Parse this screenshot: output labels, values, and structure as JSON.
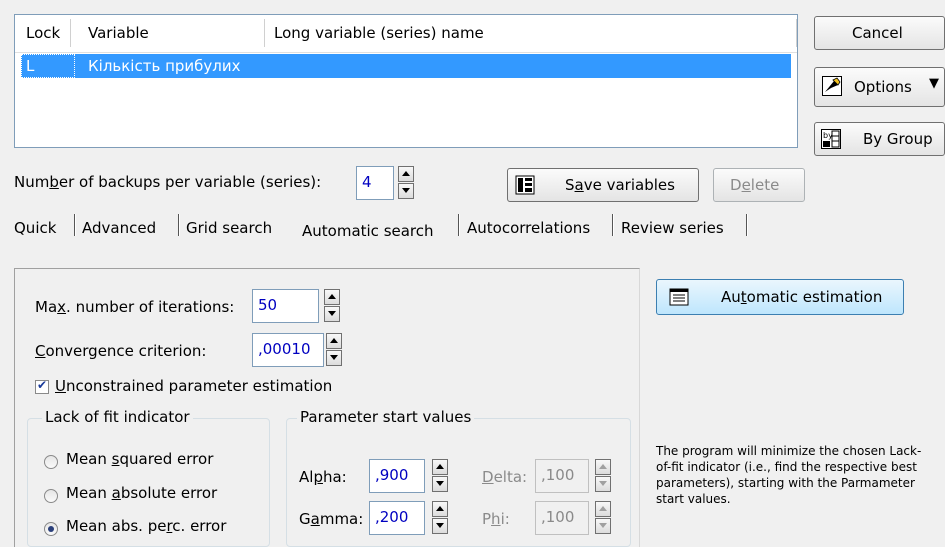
{
  "variable_list": {
    "columns": [
      "Lock",
      "Variable",
      "Long variable (series) name"
    ],
    "rows": [
      {
        "lock": "L",
        "variable": "Кількість прибулих",
        "long_name": ""
      }
    ]
  },
  "right_buttons": {
    "cancel": "Cancel",
    "options": "Options",
    "by_group": "By Group"
  },
  "backups": {
    "label_pre": "Num",
    "label_ul": "b",
    "label_post": "er of backups per variable (series):",
    "value": "4"
  },
  "actions": {
    "save_pre": "S",
    "save_ul": "a",
    "save_post": "ve variables",
    "delete_pre": "D",
    "delete_ul": "e",
    "delete_post": "lete"
  },
  "tabs": [
    "Quick",
    "Advanced",
    "Grid search",
    "Automatic search",
    "Autocorrelations",
    "Review series"
  ],
  "active_tab": "Automatic search",
  "automatic_search": {
    "max_iter_pre": "Ma",
    "max_iter_ul": "x",
    "max_iter_post": ". number of iterations:",
    "max_iter_value": "50",
    "conv_ul": "C",
    "conv_post": "onvergence criterion:",
    "conv_value": ",00010",
    "unconstrained_ul": "U",
    "unconstrained_post": "nconstrained parameter estimation",
    "unconstrained_checked": true,
    "lack_of_fit": {
      "title": "Lack of fit indicator",
      "options": [
        {
          "pre": "Mean ",
          "ul": "s",
          "post": "quared error",
          "selected": false
        },
        {
          "pre": "Mean ",
          "ul": "a",
          "post": "bsolute error",
          "selected": false
        },
        {
          "pre": "Mean abs. pe",
          "ul": "r",
          "post": "c. error",
          "selected": true
        }
      ]
    },
    "start_values": {
      "title": "Parameter start values",
      "alpha_label": "Al",
      "alpha_ul": "p",
      "alpha_post": "ha:",
      "alpha_value": ",900",
      "gamma_label": "G",
      "gamma_ul": "a",
      "gamma_post": "mma:",
      "gamma_value": ",200",
      "delta_ul": "D",
      "delta_post": "elta:",
      "delta_value": ",100",
      "phi_pre": "P",
      "phi_ul": "h",
      "phi_post": "i:",
      "phi_value": ",100"
    }
  },
  "auto_estimation": {
    "pre": "Au",
    "ul": "t",
    "post": "omatic estimation"
  },
  "note": "The program will minimize the chosen Lack-of-fit indicator (i.e., find the respective best parameters), starting with the Parmameter start values."
}
